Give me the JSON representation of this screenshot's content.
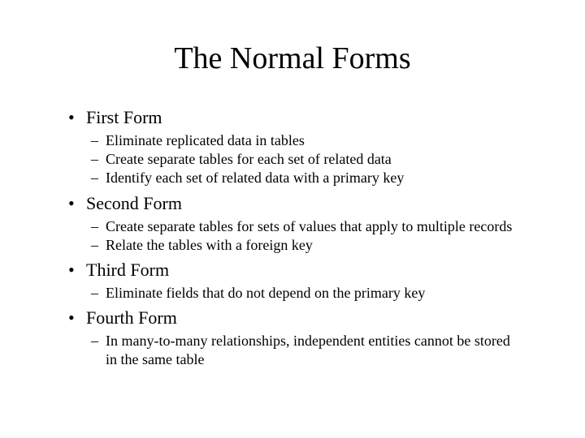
{
  "title": "The Normal Forms",
  "sections": [
    {
      "heading": "First Form",
      "items": [
        "Eliminate replicated data in tables",
        "Create separate tables for each set of related data",
        "Identify each set of related data with a primary key"
      ]
    },
    {
      "heading": "Second Form",
      "items": [
        "Create separate tables for sets of values that apply to multiple records",
        "Relate the tables with a foreign key"
      ]
    },
    {
      "heading": "Third Form",
      "items": [
        "Eliminate fields that do not depend on the primary key"
      ]
    },
    {
      "heading": "Fourth Form",
      "items": [
        "In many-to-many relationships, independent entities cannot be stored in the same table"
      ]
    }
  ]
}
